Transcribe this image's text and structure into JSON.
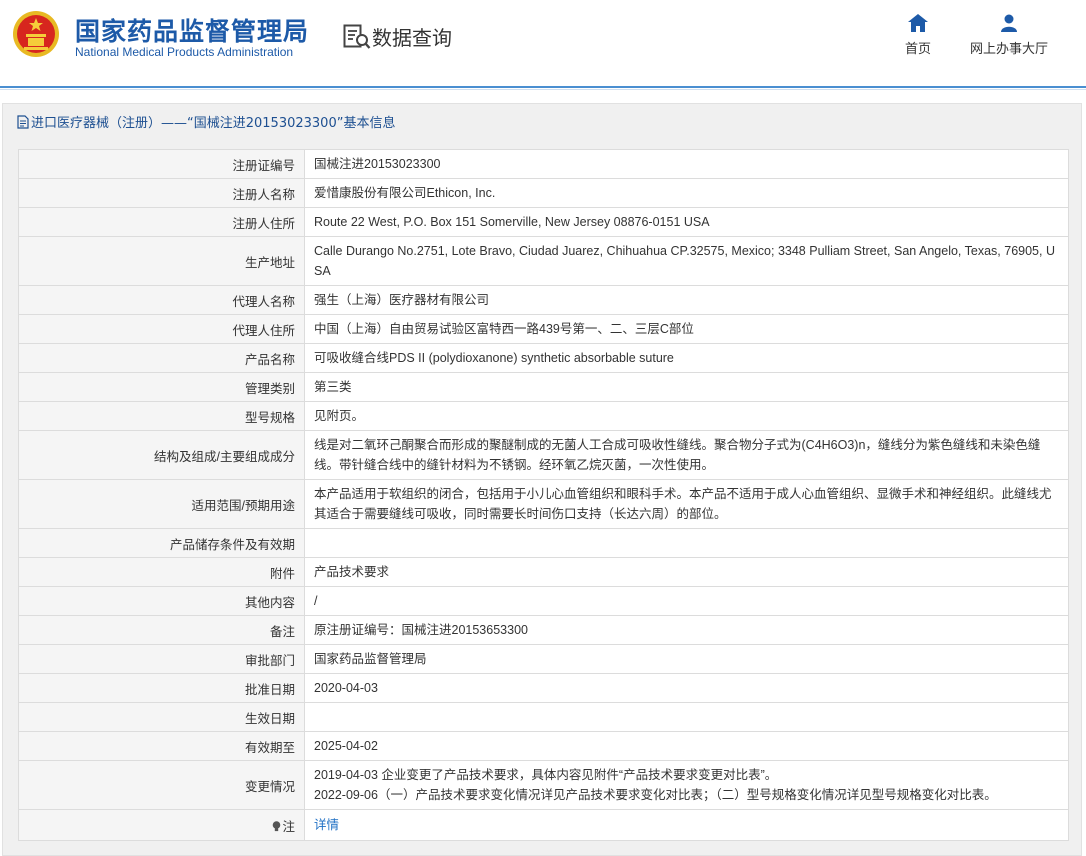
{
  "header": {
    "org_cn": "国家药品监督管理局",
    "org_en": "National Medical Products Administration",
    "query_title": "数据查询",
    "nav": [
      {
        "label": "首页",
        "icon": "home-icon"
      },
      {
        "label": "网上办事大厅",
        "icon": "user-icon"
      }
    ]
  },
  "panel": {
    "title": "进口医疗器械（注册）——“国械注进20153023300”基本信息"
  },
  "rows": [
    {
      "label": "注册证编号",
      "value": "国械注进20153023300"
    },
    {
      "label": "注册人名称",
      "value": "爱惜康股份有限公司Ethicon, Inc."
    },
    {
      "label": "注册人住所",
      "value": "Route 22 West, P.O. Box 151 Somerville, New Jersey 08876-0151 USA"
    },
    {
      "label": "生产地址",
      "value": "Calle Durango No.2751, Lote Bravo, Ciudad Juarez, Chihuahua CP.32575, Mexico; 3348 Pulliam Street, San Angelo, Texas, 76905, USA"
    },
    {
      "label": "代理人名称",
      "value": "强生（上海）医疗器材有限公司"
    },
    {
      "label": "代理人住所",
      "value": "中国（上海）自由贸易试验区富特西一路439号第一、二、三层C部位"
    },
    {
      "label": "产品名称",
      "value": "可吸收缝合线PDS II (polydioxanone) synthetic absorbable suture"
    },
    {
      "label": "管理类别",
      "value": "第三类"
    },
    {
      "label": "型号规格",
      "value": "见附页。"
    },
    {
      "label": "结构及组成/主要组成成分",
      "value": "线是对二氧环己酮聚合而形成的聚醚制成的无菌人工合成可吸收性缝线。聚合物分子式为(C4H6O3)n，缝线分为紫色缝线和未染色缝线。带针缝合线中的缝针材料为不锈钢。经环氧乙烷灭菌，一次性使用。"
    },
    {
      "label": "适用范围/预期用途",
      "value": "本产品适用于软组织的闭合，包括用于小儿心血管组织和眼科手术。本产品不适用于成人心血管组织、显微手术和神经组织。此缝线尤其适合于需要缝线可吸收，同时需要长时间伤口支持（长达六周）的部位。"
    },
    {
      "label": "产品储存条件及有效期",
      "value": ""
    },
    {
      "label": "附件",
      "value": "产品技术要求"
    },
    {
      "label": "其他内容",
      "value": "/"
    },
    {
      "label": "备注",
      "value": "原注册证编号：国械注进20153653300"
    },
    {
      "label": "审批部门",
      "value": "国家药品监督管理局"
    },
    {
      "label": "批准日期",
      "value": "2020-04-03"
    },
    {
      "label": "生效日期",
      "value": ""
    },
    {
      "label": "有效期至",
      "value": "2025-04-02"
    }
  ],
  "changes": {
    "label": "变更情况",
    "line1": "2019-04-03 企业变更了产品技术要求，具体内容见附件“产品技术要求变更对比表”。",
    "line2": "2022-09-06（一）产品技术要求变化情况详见产品技术要求变化对比表；（二）型号规格变化情况详见型号规格变化对比表。"
  },
  "note": {
    "label": "注",
    "link": "详情"
  },
  "colors": {
    "brand_blue": "#1d5aa8",
    "link_blue": "#1e6fc4"
  }
}
